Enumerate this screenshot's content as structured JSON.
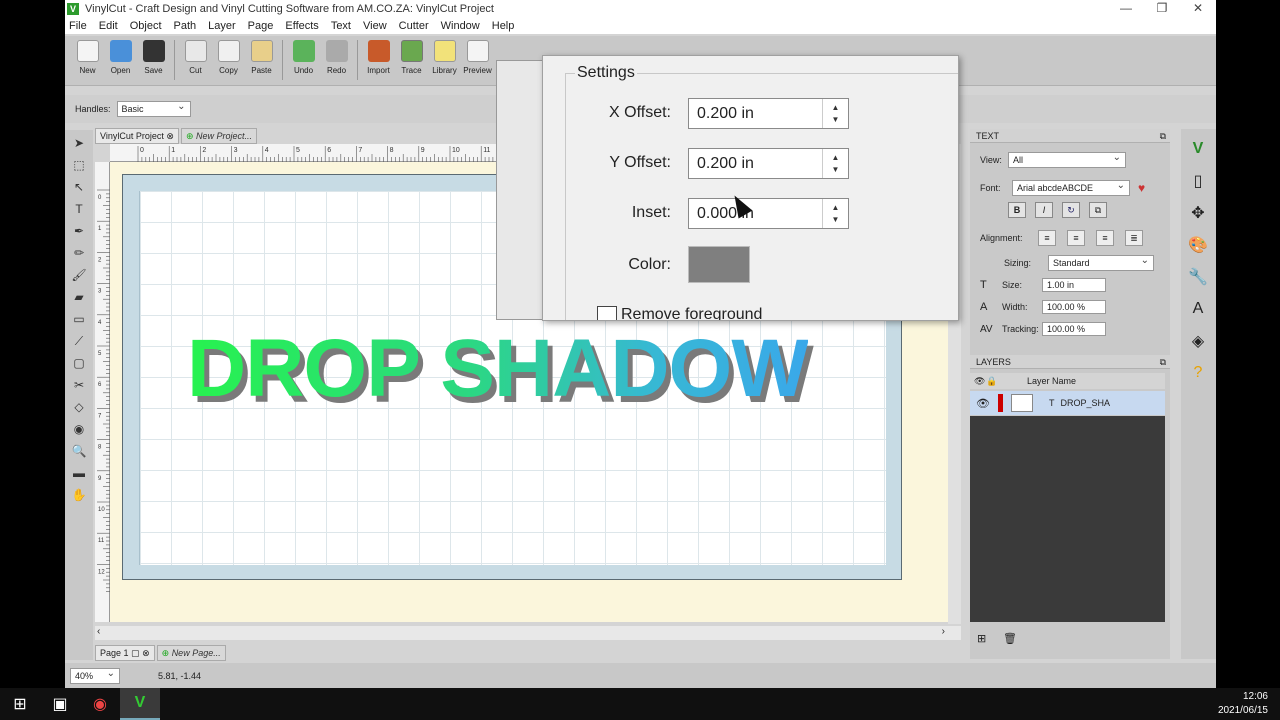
{
  "window": {
    "title": "VinylCut - Craft Design and Vinyl Cutting Software from AM.CO.ZA: VinylCut Project",
    "app_icon": "V",
    "controls": [
      "—",
      "❐",
      "✕"
    ]
  },
  "menu": [
    "File",
    "Edit",
    "Object",
    "Path",
    "Layer",
    "Page",
    "Effects",
    "Text",
    "View",
    "Cutter",
    "Window",
    "Help"
  ],
  "toolbar": {
    "buttons": [
      "New",
      "Open",
      "Save",
      "Cut",
      "Copy",
      "Paste",
      "Undo",
      "Redo",
      "Import",
      "Trace",
      "Library",
      "Preview"
    ]
  },
  "options": {
    "handles_label": "Handles:",
    "handles_value": "Basic"
  },
  "doc_tabs": {
    "active": "VinylCut Project",
    "new": "New Project..."
  },
  "page_tabs": {
    "active": "Page 1",
    "new": "New Page..."
  },
  "ruler_h": [
    "0",
    "1",
    "2",
    "3",
    "4",
    "5",
    "6",
    "7",
    "8",
    "9",
    "10",
    "11"
  ],
  "ruler_v": [
    "0",
    "1",
    "2",
    "3",
    "4",
    "5",
    "6",
    "7",
    "8",
    "9",
    "10",
    "11",
    "12"
  ],
  "canvas": {
    "text": "DROP SHADOW"
  },
  "status": {
    "zoom": "40%",
    "coords": "5.81, -1.44"
  },
  "text_panel": {
    "title": "TEXT",
    "view_label": "View:",
    "view_value": "All",
    "font_label": "Font:",
    "font_value": "Arial   abcdeABCDE",
    "format_buttons": [
      "B",
      "I",
      "↻",
      "⧉"
    ],
    "alignment_label": "Alignment:",
    "sizing_label": "Sizing:",
    "sizing_value": "Standard",
    "size_label": "Size:",
    "size_value": "1.00 in",
    "width_label": "Width:",
    "width_value": "100.00 %",
    "tracking_label": "Tracking:",
    "tracking_value": "100.00 %"
  },
  "layers_panel": {
    "title": "LAYERS",
    "column": "Layer Name",
    "layer_name": "DROP_SHA",
    "layer_color": "#cc0000"
  },
  "dialog": {
    "group_title": "Settings",
    "x_offset_label": "X Offset:",
    "x_offset_value": "0.200 in",
    "y_offset_label": "Y Offset:",
    "y_offset_value": "0.200 in",
    "inset_label": "Inset:",
    "inset_value": "0.000 in",
    "color_label": "Color:",
    "color_value": "#7f7f7f",
    "remove_fg_label": "Remove foreground"
  },
  "taskbar": {
    "time": "12:06",
    "date": "2021/06/15"
  }
}
